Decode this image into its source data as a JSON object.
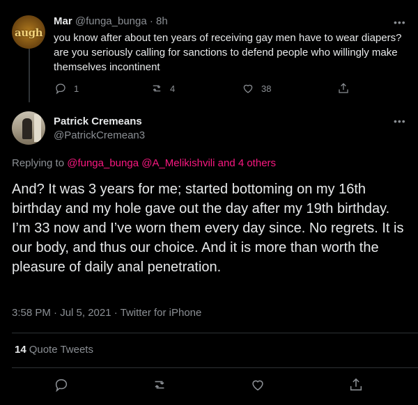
{
  "parent_tweet": {
    "avatar_text": "augh",
    "name": "Mar",
    "handle": "@funga_bunga",
    "time": " · 8h",
    "text": "you know after about ten years of receiving gay men have to wear diapers? are you seriously calling for sanctions to defend people who willingly make themselves incontinent",
    "reply_count": "1",
    "retweet_count": "4",
    "like_count": "38",
    "more_icon": "more-horizontal-icon"
  },
  "main_tweet": {
    "name": "Patrick Cremeans",
    "handle": "@PatrickCremean3",
    "replying_prefix": "Replying to ",
    "mention_1": "@funga_bunga",
    "mention_2": "@A_Melikishvili",
    "mention_others": "and 4 others",
    "text": "And? It was 3 years for me; started bottoming on my 16th birthday and my hole gave out the day after my 19th birthday. I’m 33 now and I’ve worn them every day since. No regrets. It is our body, and thus our choice. And it is more than worth the pleasure of daily anal penetration.",
    "timestamp": "3:58 PM · Jul 5, 2021 · Twitter for iPhone",
    "quote_count": "14",
    "quote_label": "Quote Tweets"
  },
  "colors": {
    "background": "#000000",
    "text_primary": "#e7e9ea",
    "text_secondary": "#8b8f94",
    "mention": "#f91880",
    "divider": "#2f3336"
  }
}
